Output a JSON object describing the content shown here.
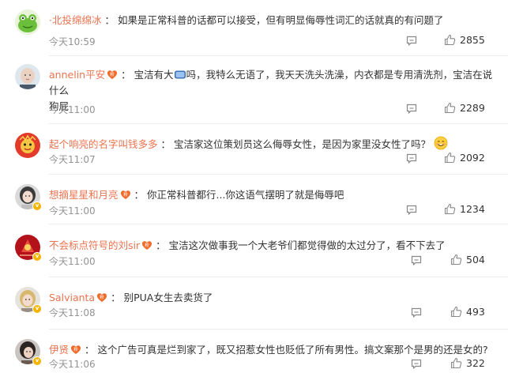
{
  "comments": [
    {
      "username": "·北投绵绵冰",
      "colon": "：",
      "text": "如果是正常科普的话都可以接受，但有明显侮辱性词汇的话就真的有问题了",
      "time": "今天10:59",
      "likes": "2855",
      "avatar": "frog-avatar",
      "has_fan_badge": false,
      "has_v_badge": false
    },
    {
      "username": "annelin平安",
      "colon": "：",
      "text_a": "宝洁有大",
      "text_b": "吗，我特么无语了，我天天洗头洗澡，内衣都是专用清洗剂，宝洁在说什么",
      "text_c": "狗屁",
      "time": "今天11:00",
      "likes": "2289",
      "avatar": "baby-avatar",
      "has_fan_badge": true,
      "has_v_badge": false
    },
    {
      "username": "起个响亮的名字叫钱多多",
      "colon": "：",
      "text": "宝洁家这位策划员这么侮辱女性，是因为家里没女性了吗？",
      "time": "今天11:07",
      "likes": "2092",
      "avatar": "red-lion-avatar",
      "has_fan_badge": false,
      "has_v_badge": false
    },
    {
      "username": "想摘星星和月亮",
      "colon": "：",
      "text": "你正常科普都行...你这语气摆明了就是侮辱吧",
      "time": "今天11:00",
      "likes": "1234",
      "avatar": "girl-avatar",
      "has_fan_badge": true,
      "has_v_badge": true
    },
    {
      "username": "不会标点符号的刘sir",
      "colon": "：",
      "text": "宝洁这次做事我一个大老爷们都觉得做的太过分了，看不下去了",
      "time": "今天11:00",
      "likes": "504",
      "avatar": "red-art-avatar",
      "has_fan_badge": true,
      "has_v_badge": true
    },
    {
      "username": "Salvianta",
      "colon": "：",
      "text": "别PUA女生去卖货了",
      "time": "今天11:08",
      "likes": "493",
      "avatar": "blonde-avatar",
      "has_fan_badge": true,
      "has_v_badge": true
    },
    {
      "username": "伊贤",
      "colon": "：",
      "text": "这个广告可真是烂到家了，既又招惹女性也贬低了所有男性。搞文案那个是男的还是女的?",
      "time": "今天11:06",
      "likes": "322",
      "avatar": "dark-hair-avatar",
      "has_fan_badge": true,
      "has_v_badge": true
    }
  ],
  "icons": {
    "reply": "comment-bubble-icon",
    "like": "thumbs-up-icon",
    "fan": "fan-badge-icon",
    "verified": "verified-v-icon"
  },
  "colors": {
    "username": "#eb7350",
    "text": "#333333",
    "time": "#939393",
    "icon": "#888888",
    "divider": "#ededed"
  }
}
